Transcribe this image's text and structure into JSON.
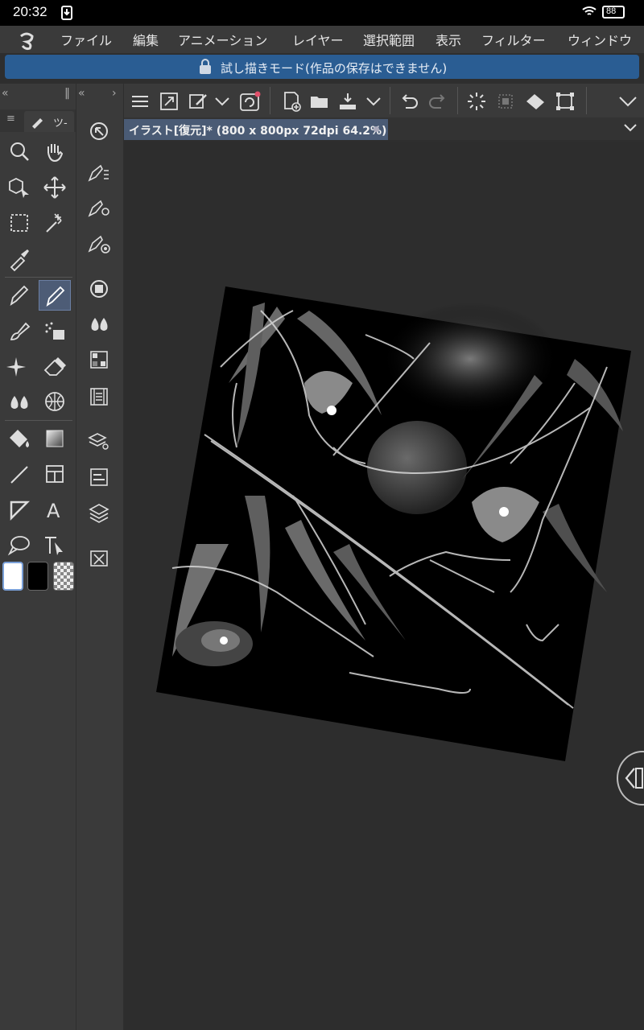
{
  "status_bar": {
    "time": "20:32",
    "battery": "88"
  },
  "menu": [
    {
      "label": "ファイル"
    },
    {
      "label": "編集"
    },
    {
      "label": "アニメーション"
    },
    {
      "label": "レイヤー"
    },
    {
      "label": "選択範囲"
    },
    {
      "label": "表示"
    },
    {
      "label": "フィルター"
    },
    {
      "label": "ウィンドウ"
    }
  ],
  "banner": {
    "text": "試し描きモード(作品の保存はできません)"
  },
  "tool_panel": {
    "tab_label": "ツ-"
  },
  "document_tab": {
    "title": "イラスト[復元]* (800 x 800px 72dpi 64.2%)"
  },
  "colors": {
    "accent": "#4a5b75",
    "banner": "#2a5d93",
    "panel": "#3a3a3a",
    "canvas_bg": "#2d2d2d"
  }
}
